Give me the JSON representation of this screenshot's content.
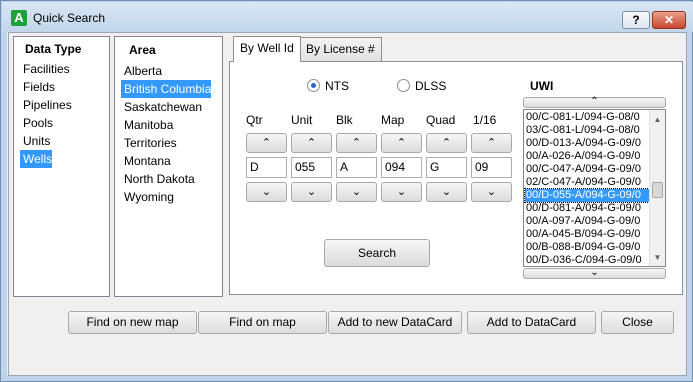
{
  "window": {
    "title": "Quick Search",
    "app_icon_letter": "A"
  },
  "titlebar_buttons": {
    "help": "?",
    "close": "✕"
  },
  "data_type": {
    "title": "Data Type",
    "items": [
      "Facilities",
      "Fields",
      "Pipelines",
      "Pools",
      "Units",
      "Wells"
    ],
    "selected_index": 5
  },
  "area": {
    "title": "Area",
    "items": [
      "Alberta",
      "British Columbia",
      "Saskatchewan",
      "Manitoba",
      "Territories",
      "Montana",
      "North Dakota",
      "Wyoming"
    ],
    "selected_index": 1
  },
  "tabs": [
    {
      "label": "By Well Id",
      "active": true
    },
    {
      "label": "By License #",
      "active": false
    }
  ],
  "survey": {
    "nts_label": "NTS",
    "dlss_label": "DLSS",
    "selected": "NTS"
  },
  "fields": {
    "qtr": {
      "label": "Qtr",
      "value": "D"
    },
    "unit": {
      "label": "Unit",
      "value": "055"
    },
    "blk": {
      "label": "Blk",
      "value": "A"
    },
    "map": {
      "label": "Map",
      "value": "094"
    },
    "quad": {
      "label": "Quad",
      "value": "G"
    },
    "sixteenth": {
      "label": "1/16",
      "value": "09"
    }
  },
  "search_button": "Search",
  "uwi": {
    "title": "UWI",
    "items": [
      "00/C-081-L/094-G-08/0",
      "03/C-081-L/094-G-08/0",
      "00/D-013-A/094-G-09/0",
      "00/A-026-A/094-G-09/0",
      "00/C-047-A/094-G-09/0",
      "02/C-047-A/094-G-09/0",
      "00/D-055-A/094-G-09/0",
      "00/D-081-A/094-G-09/0",
      "00/A-097-A/094-G-09/0",
      "00/A-045-B/094-G-09/0",
      "00/B-088-B/094-G-09/0",
      "00/D-036-C/094-G-09/0"
    ],
    "selected_index": 6
  },
  "bottom_buttons": {
    "find_new_map": "Find on new map",
    "find_map": "Find on map",
    "add_new_datacard": "Add to new DataCard",
    "add_datacard": "Add to DataCard",
    "close": "Close"
  },
  "icons": {
    "up": "⌃",
    "down": "⌄"
  }
}
